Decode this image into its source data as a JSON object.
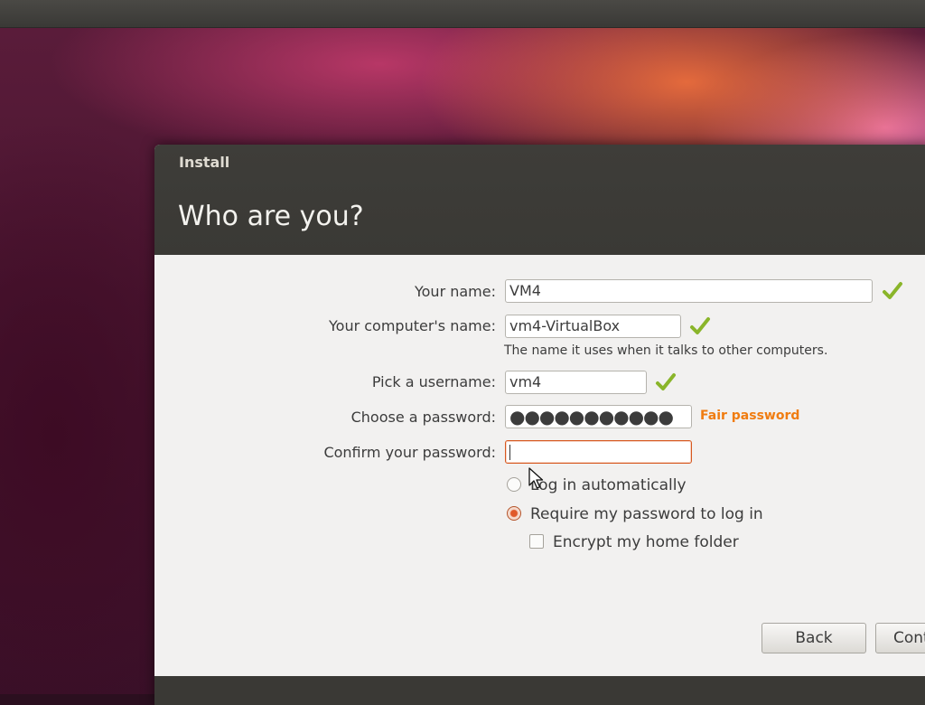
{
  "window": {
    "title": "Install",
    "heading": "Who are you?"
  },
  "form": {
    "name_label": "Your name:",
    "name_value": "VM4",
    "computer_label": "Your computer's name:",
    "computer_value": "vm4-VirtualBox",
    "computer_hint": "The name it uses when it talks to other computers.",
    "username_label": "Pick a username:",
    "username_value": "vm4",
    "password_label": "Choose a password:",
    "password_value": "●●●●●●●●●●●",
    "password_strength": "Fair password",
    "confirm_label": "Confirm your password:",
    "confirm_value": ""
  },
  "options": {
    "login_auto": "Log in automatically",
    "require_password": "Require my password to log in",
    "encrypt_home": "Encrypt my home folder",
    "selected": "require_password",
    "encrypt_checked": false
  },
  "buttons": {
    "back": "Back",
    "continue": "Cont"
  },
  "colors": {
    "accent": "#e05a2a",
    "valid_check": "#8ab52a",
    "strength_fair": "#f07c10",
    "error_border": "#d7581f"
  },
  "icons": {
    "valid": "check-icon",
    "pointer": "mouse-pointer-icon"
  }
}
